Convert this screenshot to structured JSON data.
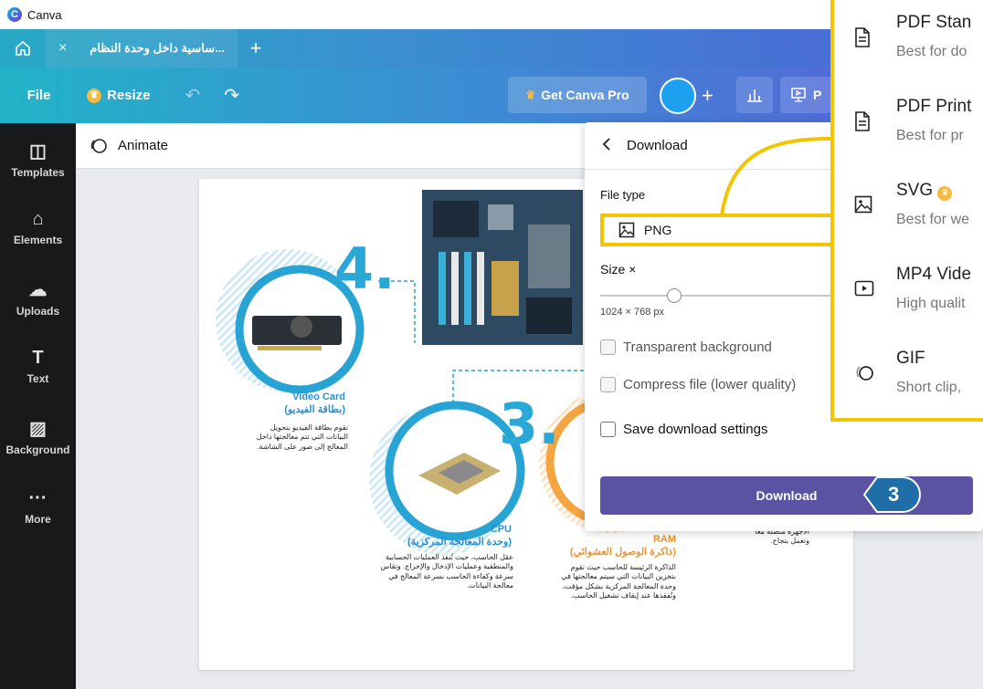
{
  "window": {
    "title": "Canva"
  },
  "tabs": [
    {
      "label": "...ساسية داخل وحدة النظام",
      "close": "×"
    }
  ],
  "new_tab": "+",
  "toolbar": {
    "file": "File",
    "resize": "Resize",
    "get_pro": "Get Canva Pro",
    "plus": "+",
    "present_short": "P"
  },
  "sidebar": {
    "items": [
      {
        "label": "Templates",
        "icon": "templates-icon"
      },
      {
        "label": "Elements",
        "icon": "elements-icon"
      },
      {
        "label": "Uploads",
        "icon": "uploads-icon"
      },
      {
        "label": "Text",
        "icon": "text-icon"
      },
      {
        "label": "Background",
        "icon": "background-icon"
      },
      {
        "label": "More",
        "icon": "more-icon"
      }
    ]
  },
  "editor": {
    "animate": "Animate"
  },
  "download_panel": {
    "title": "Download",
    "file_type_label": "File type",
    "file_type_value": "PNG",
    "size_label": "Size ×",
    "size_value": "1024 × 768 px",
    "size_slider_fraction": 0.31,
    "transparent_bg": "Transparent background",
    "compress": "Compress file (lower quality)",
    "save_settings": "Save download settings",
    "download_button": "Download",
    "step_badge": "3"
  },
  "file_types": [
    {
      "name": "PDF Stan",
      "desc": "Best for do",
      "icon": "document-icon"
    },
    {
      "name": "PDF Print",
      "desc": "Best for pr",
      "icon": "document-icon"
    },
    {
      "name": "SVG",
      "desc": "Best for we",
      "icon": "image-icon",
      "pro": true
    },
    {
      "name": "MP4 Vide",
      "desc": "High qualit",
      "icon": "video-icon"
    },
    {
      "name": "GIF",
      "desc": "Short clip,",
      "icon": "gif-icon"
    }
  ],
  "infographic": {
    "num_4": "4.",
    "num_3": "3.",
    "video_card_title": "Video Card",
    "video_card_title_ar": "(بطاقة الفيديو)",
    "video_card_body": "تقوم بطاقة الفيديو بتحويل البيانات التي تتم معالجتها داخل المعالج إلى صور على الشاشة.",
    "cpu_title": "CPU",
    "cpu_title_ar": "(وحدة المعالجة المركزية)",
    "cpu_body": "عقل الحاسب، حيث تُنفذ العمليات الحسابية والمنطقية وعمليات الإدخال والإخراج. وتقاس سرعة وكفاءة الحاسب بسرعة المعالج في معالجة البيانات.",
    "ram_title": "RAM",
    "ram_title_ar": "(ذاكرة الوصول العشوائي)",
    "ram_body": "الذاكرة الرئيسة للحاسب حيث تقوم بتخزين البيانات التي سيتم معالجتها في وحدة المعالجة المركزية بشكل مؤقت، وتُفقدها عند إيقاف تشغيل الحاسب.",
    "mb_body": "الأجهزة متصلة معًا وتعمل بنجاح."
  },
  "colors": {
    "accent": "#f5c400",
    "download_btn": "#5b52a3",
    "sidebar": "#18191b",
    "info_blue": "#2a8fcf"
  }
}
